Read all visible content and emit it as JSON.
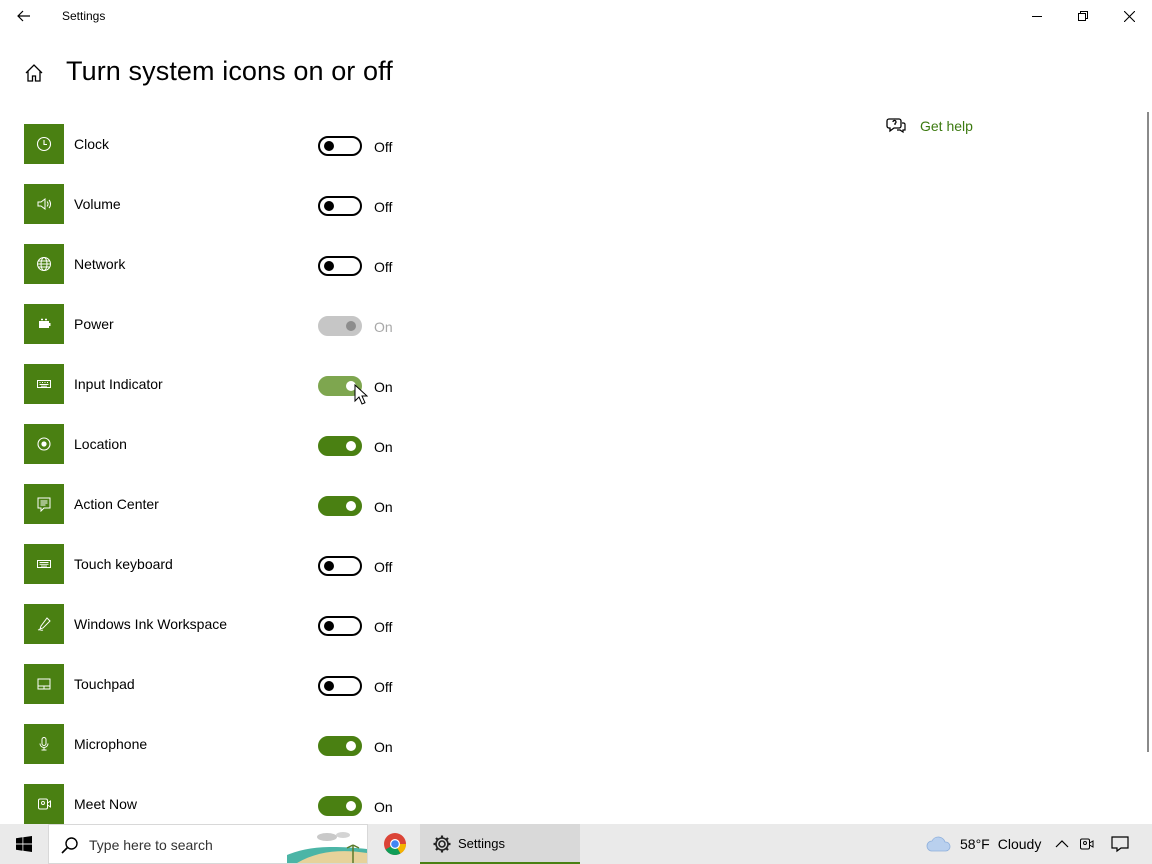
{
  "window": {
    "title": "Settings"
  },
  "page": {
    "title": "Turn system icons on or off"
  },
  "help": {
    "label": "Get help"
  },
  "items": [
    {
      "label": "Clock",
      "state": "Off",
      "icon": "clock-icon"
    },
    {
      "label": "Volume",
      "state": "Off",
      "icon": "volume-icon"
    },
    {
      "label": "Network",
      "state": "Off",
      "icon": "globe-icon"
    },
    {
      "label": "Power",
      "state": "On",
      "icon": "battery-icon"
    },
    {
      "label": "Input Indicator",
      "state": "On",
      "icon": "keyboard-icon"
    },
    {
      "label": "Location",
      "state": "On",
      "icon": "location-icon"
    },
    {
      "label": "Action Center",
      "state": "On",
      "icon": "action-center-icon"
    },
    {
      "label": "Touch keyboard",
      "state": "Off",
      "icon": "touch-keyboard-icon"
    },
    {
      "label": "Windows Ink Workspace",
      "state": "Off",
      "icon": "pen-icon"
    },
    {
      "label": "Touchpad",
      "state": "Off",
      "icon": "touchpad-icon"
    },
    {
      "label": "Microphone",
      "state": "On",
      "icon": "microphone-icon"
    },
    {
      "label": "Meet Now",
      "state": "On",
      "icon": "meet-now-icon"
    }
  ],
  "taskbar": {
    "search_placeholder": "Type here to search",
    "settings_label": "Settings",
    "weather_temp": "58°F",
    "weather_condition": "Cloudy"
  },
  "colors": {
    "accent": "#4a8012",
    "link": "#3c7a10"
  }
}
